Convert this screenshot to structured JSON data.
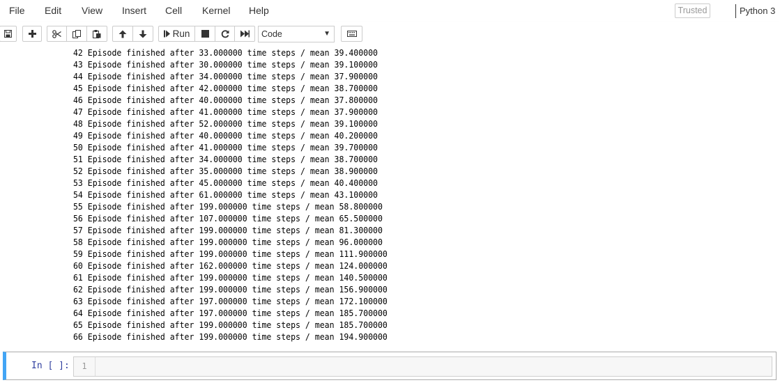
{
  "menubar": {
    "items": [
      "File",
      "Edit",
      "View",
      "Insert",
      "Cell",
      "Kernel",
      "Help"
    ],
    "trusted_label": "Trusted",
    "kernel_name": "Python 3"
  },
  "toolbar": {
    "run_label": "Run",
    "cell_type": "Code",
    "icons": [
      "save-icon",
      "plus-icon",
      "cut-icon",
      "copy-icon",
      "paste-icon",
      "arrow-up-icon",
      "arrow-down-icon",
      "step-forward-icon",
      "stop-icon",
      "restart-icon",
      "fast-forward-icon",
      "keyboard-icon"
    ]
  },
  "output": {
    "lines": [
      "42 Episode finished after 33.000000 time steps / mean 39.400000",
      "43 Episode finished after 30.000000 time steps / mean 39.100000",
      "44 Episode finished after 34.000000 time steps / mean 37.900000",
      "45 Episode finished after 42.000000 time steps / mean 38.700000",
      "46 Episode finished after 40.000000 time steps / mean 37.800000",
      "47 Episode finished after 41.000000 time steps / mean 37.900000",
      "48 Episode finished after 52.000000 time steps / mean 39.100000",
      "49 Episode finished after 40.000000 time steps / mean 40.200000",
      "50 Episode finished after 41.000000 time steps / mean 39.700000",
      "51 Episode finished after 34.000000 time steps / mean 38.700000",
      "52 Episode finished after 35.000000 time steps / mean 38.900000",
      "53 Episode finished after 45.000000 time steps / mean 40.400000",
      "54 Episode finished after 61.000000 time steps / mean 43.100000",
      "55 Episode finished after 199.000000 time steps / mean 58.800000",
      "56 Episode finished after 107.000000 time steps / mean 65.500000",
      "57 Episode finished after 199.000000 time steps / mean 81.300000",
      "58 Episode finished after 199.000000 time steps / mean 96.000000",
      "59 Episode finished after 199.000000 time steps / mean 111.900000",
      "60 Episode finished after 162.000000 time steps / mean 124.000000",
      "61 Episode finished after 199.000000 time steps / mean 140.500000",
      "62 Episode finished after 199.000000 time steps / mean 156.900000",
      "63 Episode finished after 197.000000 time steps / mean 172.100000",
      "64 Episode finished after 197.000000 time steps / mean 185.700000",
      "65 Episode finished after 199.000000 time steps / mean 185.700000",
      "66 Episode finished after 199.000000 time steps / mean 194.900000"
    ]
  },
  "cell": {
    "prompt": "In [ ]:",
    "line_number": "1"
  },
  "colors": {
    "selected_cell_border": "#42a5f5",
    "prompt_color": "#303f9f"
  }
}
